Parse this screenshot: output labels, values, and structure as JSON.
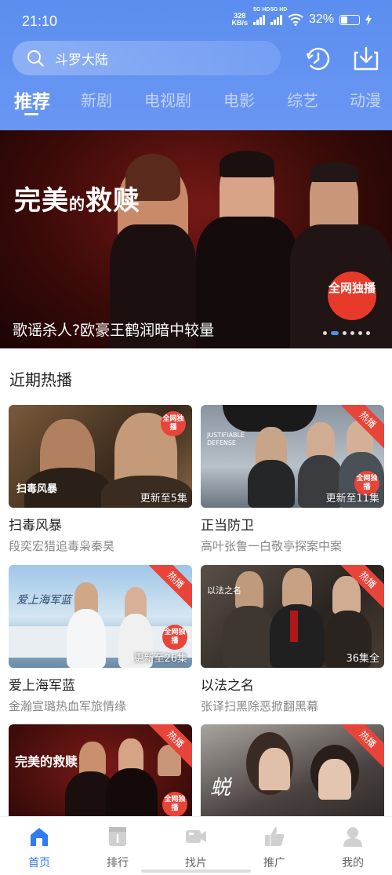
{
  "status_bar": {
    "time": "21:10",
    "speed_value": "328",
    "speed_unit": "KB/s",
    "sig1": "5G HD",
    "sig2": "5G HD",
    "battery": "32%"
  },
  "header": {
    "search_placeholder": "斗罗大陆",
    "history_icon": "history-clock-icon",
    "download_icon": "download-icon"
  },
  "tabs": [
    "推荐",
    "新剧",
    "电视剧",
    "电影",
    "综艺",
    "动漫"
  ],
  "banner": {
    "logo_text_a": "完美",
    "logo_text_b": "的",
    "logo_text_c": "救赎",
    "badge": "全网独播",
    "caption": "歌谣杀人?欧豪王鹤润暗中较量",
    "page_index": 2,
    "page_count": 6
  },
  "section": {
    "title": "近期热播"
  },
  "cards": [
    {
      "title": "扫毒风暴",
      "desc": "段奕宏猎追毒枭秦昊",
      "episodes": "更新至5集",
      "corner": "",
      "circle": "全网独播",
      "logo": "扫毒风暴"
    },
    {
      "title": "正当防卫",
      "desc": "高叶张鲁一白敬亭探案中案",
      "episodes": "更新至11集",
      "corner": "热播",
      "circle": "全网独播",
      "logo": "JUSTIFIABLE DEFENSE"
    },
    {
      "title": "爱上海军蓝",
      "desc": "金瀚宣璐热血军旅情缘",
      "episodes": "更新至26集",
      "corner": "热播",
      "circle": "全网独播",
      "logo": "爱上海军蓝"
    },
    {
      "title": "以法之名",
      "desc": "张译扫黑除恶掀翻黑幕",
      "episodes": "36集全",
      "corner": "热播",
      "circle": "",
      "logo": "以法之名"
    },
    {
      "title": "",
      "desc": "",
      "episodes": "",
      "corner": "热播",
      "circle": "全网独播",
      "logo": "完美的救赎"
    },
    {
      "title": "",
      "desc": "",
      "episodes": "",
      "corner": "热播",
      "circle": "",
      "logo": "蜕"
    }
  ],
  "nav": [
    {
      "label": "首页",
      "icon": "home-icon"
    },
    {
      "label": "排行",
      "icon": "ranking-icon"
    },
    {
      "label": "找片",
      "icon": "video-camera-icon"
    },
    {
      "label": "推广",
      "icon": "thumbs-up-icon"
    },
    {
      "label": "我的",
      "icon": "profile-icon"
    }
  ],
  "colors": {
    "header_bg": "#5b8ef0",
    "accent": "#2f7bf0",
    "badge_red": "#e8453a"
  }
}
